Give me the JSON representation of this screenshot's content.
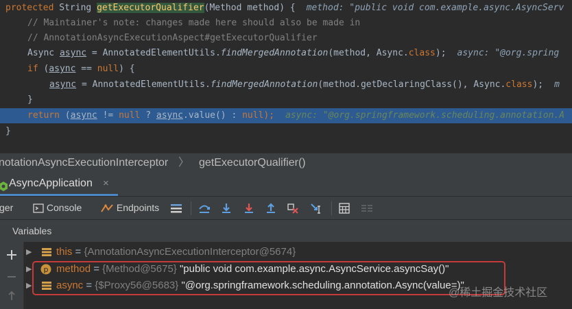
{
  "editor": {
    "line1": {
      "kw_protected": "protected",
      "type_string": " String ",
      "method_name": "getExecutorQualifier",
      "params": "(Method method) {",
      "inline_hint": "method: \"public void com.example.async.AsyncServ"
    },
    "line2": {
      "comment": "// Maintainer's note: changes made here should also be made in"
    },
    "line3": {
      "comment": "// AnnotationAsyncExecutionAspect#getExecutorQualifier"
    },
    "line4": {
      "type": "Async ",
      "var": "async",
      "assign": " = AnnotatedElementUtils.",
      "method": "findMergedAnnotation",
      "args_pre": "(method, Async.",
      "kw_class": "class",
      "args_post": ");",
      "inline_hint": "async: \"@org.spring"
    },
    "line5": {
      "kw_if": "if",
      "open": " (",
      "var": "async",
      "eq": " == ",
      "kw_null": "null",
      "close": ") {"
    },
    "line6": {
      "var": "async",
      "assign": " = AnnotatedElementUtils.",
      "method": "findMergedAnnotation",
      "args_pre": "(method.getDeclaringClass(), Async.",
      "kw_class": "class",
      "args_post": ");",
      "inline_hint": "m"
    },
    "line7": {
      "brace": "}"
    },
    "line8": {
      "kw_return": "return",
      "open": " (",
      "var1": "async",
      "neq": " != ",
      "kw_null1": "null",
      "q": " ? ",
      "var2": "async",
      "call": ".value() : ",
      "kw_null2": "null",
      "close": ");",
      "inline_hint": "async: \"@org.springframework.scheduling.annotation.A"
    },
    "line9": {
      "brace": "}"
    }
  },
  "breadcrumb": {
    "class_name": "notationAsyncExecutionInterceptor",
    "separator": "〉",
    "method_name": "getExecutorQualifier()"
  },
  "debug_tab": {
    "label": "AsyncApplication",
    "close": "×"
  },
  "toolbar": {
    "debugger_label": "ger",
    "console_label": "Console",
    "endpoints_label": "Endpoints"
  },
  "variables": {
    "header": "Variables",
    "rows": [
      {
        "name": "this",
        "eq": " = ",
        "type": "{AnnotationAsyncExecutionInterceptor@5674}",
        "value": ""
      },
      {
        "name": "method",
        "eq": " = ",
        "type": "{Method@5675}",
        "value": " \"public void com.example.async.AsyncService.asyncSay()\""
      },
      {
        "name": "async",
        "eq": " = ",
        "type": "{$Proxy56@5683}",
        "value": " \"@org.springframework.scheduling.annotation.Async(value=)\""
      }
    ]
  },
  "watermark": "@稀土掘金技术社区",
  "colors": {
    "keyword": "#cc7832",
    "method_highlight": "#ffc66d",
    "comment": "#808080",
    "execution_line": "#2d5a91",
    "highlight_box": "#c53b3b",
    "tab_underline": "#4a88c7"
  }
}
